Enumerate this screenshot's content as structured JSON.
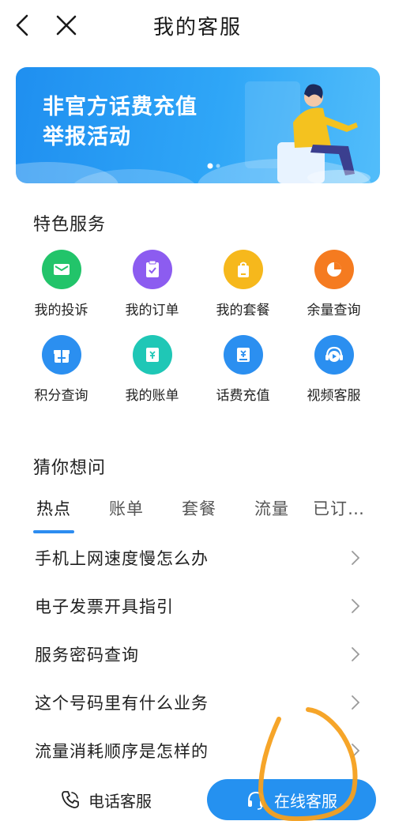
{
  "header": {
    "title": "我的客服",
    "back_icon": "chevron-left-icon",
    "close_icon": "close-icon"
  },
  "banner": {
    "line1": "非官方话费充值",
    "line2": "举报活动"
  },
  "featured": {
    "title": "特色服务",
    "items": [
      {
        "label": "我的投诉",
        "icon": "mail-icon",
        "color": "#22c46a"
      },
      {
        "label": "我的订单",
        "icon": "clipboard-check-icon",
        "color": "#8c5cf0"
      },
      {
        "label": "我的套餐",
        "icon": "package-bag-icon",
        "color": "#f6b81c"
      },
      {
        "label": "余量查询",
        "icon": "pie-chart-icon",
        "color": "#f57b20"
      },
      {
        "label": "积分查询",
        "icon": "gift-icon",
        "color": "#2b8ff0"
      },
      {
        "label": "我的账单",
        "icon": "bill-icon",
        "color": "#1fc7b6"
      },
      {
        "label": "话费充值",
        "icon": "topup-card-icon",
        "color": "#2b8ff0"
      },
      {
        "label": "视频客服",
        "icon": "video-support-icon",
        "color": "#2b8ff0"
      }
    ]
  },
  "guess": {
    "title": "猜你想问",
    "tabs": [
      "热点",
      "账单",
      "套餐",
      "流量",
      "已订…"
    ],
    "active_tab": 0,
    "questions": [
      "手机上网速度慢怎么办",
      "电子发票开具指引",
      "服务密码查询",
      "这个号码里有什么业务",
      "流量消耗顺序是怎样的"
    ]
  },
  "bottom": {
    "phone_label": "电话客服",
    "online_label": "在线客服",
    "phone_icon": "phone-icon",
    "online_icon": "headset-icon"
  },
  "colors": {
    "accent": "#2591f0",
    "annotation": "#f5a01e"
  }
}
